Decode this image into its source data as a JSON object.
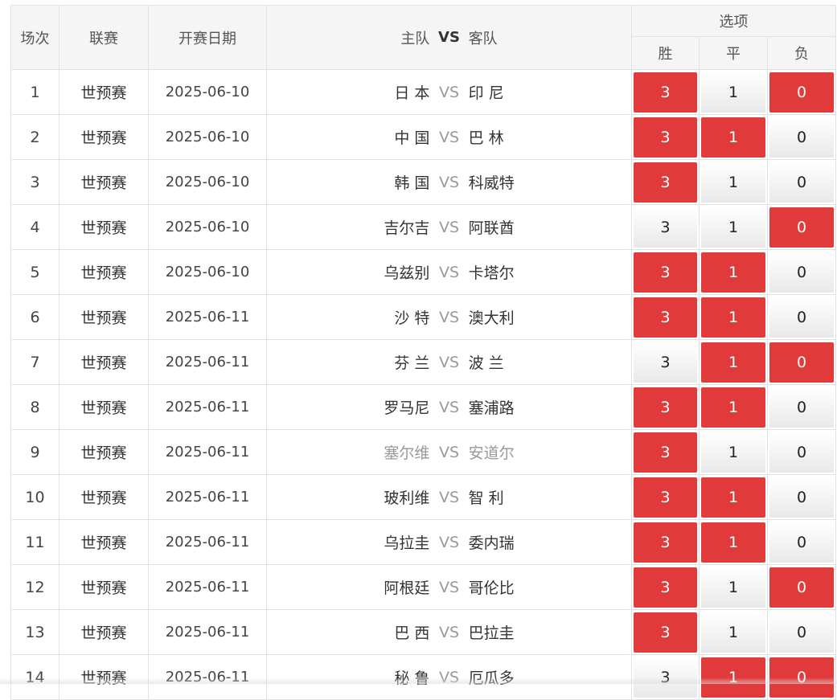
{
  "header": {
    "col_round": "场次",
    "col_league": "联赛",
    "col_date": "开赛日期",
    "col_home": "主队",
    "col_vs": "VS",
    "col_away": "客队",
    "col_options": "选项",
    "opt_win": "胜",
    "opt_draw": "平",
    "opt_lose": "负"
  },
  "colors": {
    "selected": "#e03a3a",
    "dim_text": "#999999"
  },
  "rows": [
    {
      "no": "1",
      "league": "世预赛",
      "date": "2025-06-10",
      "home": "日 本",
      "vs": "VS",
      "away": "印 尼",
      "w": "3",
      "d": "1",
      "l": "0",
      "w_on": true,
      "d_on": false,
      "l_on": true,
      "dim": false
    },
    {
      "no": "2",
      "league": "世预赛",
      "date": "2025-06-10",
      "home": "中 国",
      "vs": "VS",
      "away": "巴 林",
      "w": "3",
      "d": "1",
      "l": "0",
      "w_on": true,
      "d_on": true,
      "l_on": false,
      "dim": false
    },
    {
      "no": "3",
      "league": "世预赛",
      "date": "2025-06-10",
      "home": "韩 国",
      "vs": "VS",
      "away": "科威特",
      "w": "3",
      "d": "1",
      "l": "0",
      "w_on": true,
      "d_on": false,
      "l_on": false,
      "dim": false
    },
    {
      "no": "4",
      "league": "世预赛",
      "date": "2025-06-10",
      "home": "吉尔吉",
      "vs": "VS",
      "away": "阿联酋",
      "w": "3",
      "d": "1",
      "l": "0",
      "w_on": false,
      "d_on": false,
      "l_on": true,
      "dim": false
    },
    {
      "no": "5",
      "league": "世预赛",
      "date": "2025-06-10",
      "home": "乌兹别",
      "vs": "VS",
      "away": "卡塔尔",
      "w": "3",
      "d": "1",
      "l": "0",
      "w_on": true,
      "d_on": true,
      "l_on": false,
      "dim": false
    },
    {
      "no": "6",
      "league": "世预赛",
      "date": "2025-06-11",
      "home": "沙 特",
      "vs": "VS",
      "away": "澳大利",
      "w": "3",
      "d": "1",
      "l": "0",
      "w_on": true,
      "d_on": true,
      "l_on": false,
      "dim": false
    },
    {
      "no": "7",
      "league": "世预赛",
      "date": "2025-06-11",
      "home": "芬 兰",
      "vs": "VS",
      "away": "波 兰",
      "w": "3",
      "d": "1",
      "l": "0",
      "w_on": false,
      "d_on": true,
      "l_on": true,
      "dim": false
    },
    {
      "no": "8",
      "league": "世预赛",
      "date": "2025-06-11",
      "home": "罗马尼",
      "vs": "VS",
      "away": "塞浦路",
      "w": "3",
      "d": "1",
      "l": "0",
      "w_on": true,
      "d_on": true,
      "l_on": false,
      "dim": false
    },
    {
      "no": "9",
      "league": "世预赛",
      "date": "2025-06-11",
      "home": "塞尔维",
      "vs": "VS",
      "away": "安道尔",
      "w": "3",
      "d": "1",
      "l": "0",
      "w_on": true,
      "d_on": false,
      "l_on": false,
      "dim": true
    },
    {
      "no": "10",
      "league": "世预赛",
      "date": "2025-06-11",
      "home": "玻利维",
      "vs": "VS",
      "away": "智 利",
      "w": "3",
      "d": "1",
      "l": "0",
      "w_on": true,
      "d_on": true,
      "l_on": false,
      "dim": false
    },
    {
      "no": "11",
      "league": "世预赛",
      "date": "2025-06-11",
      "home": "乌拉圭",
      "vs": "VS",
      "away": "委内瑞",
      "w": "3",
      "d": "1",
      "l": "0",
      "w_on": true,
      "d_on": true,
      "l_on": false,
      "dim": false
    },
    {
      "no": "12",
      "league": "世预赛",
      "date": "2025-06-11",
      "home": "阿根廷",
      "vs": "VS",
      "away": "哥伦比",
      "w": "3",
      "d": "1",
      "l": "0",
      "w_on": true,
      "d_on": false,
      "l_on": true,
      "dim": false
    },
    {
      "no": "13",
      "league": "世预赛",
      "date": "2025-06-11",
      "home": "巴 西",
      "vs": "VS",
      "away": "巴拉圭",
      "w": "3",
      "d": "1",
      "l": "0",
      "w_on": true,
      "d_on": false,
      "l_on": false,
      "dim": false
    },
    {
      "no": "14",
      "league": "世预赛",
      "date": "2025-06-11",
      "home": "秘 鲁",
      "vs": "VS",
      "away": "厄瓜多",
      "w": "3",
      "d": "1",
      "l": "0",
      "w_on": false,
      "d_on": true,
      "l_on": true,
      "dim": false
    }
  ]
}
